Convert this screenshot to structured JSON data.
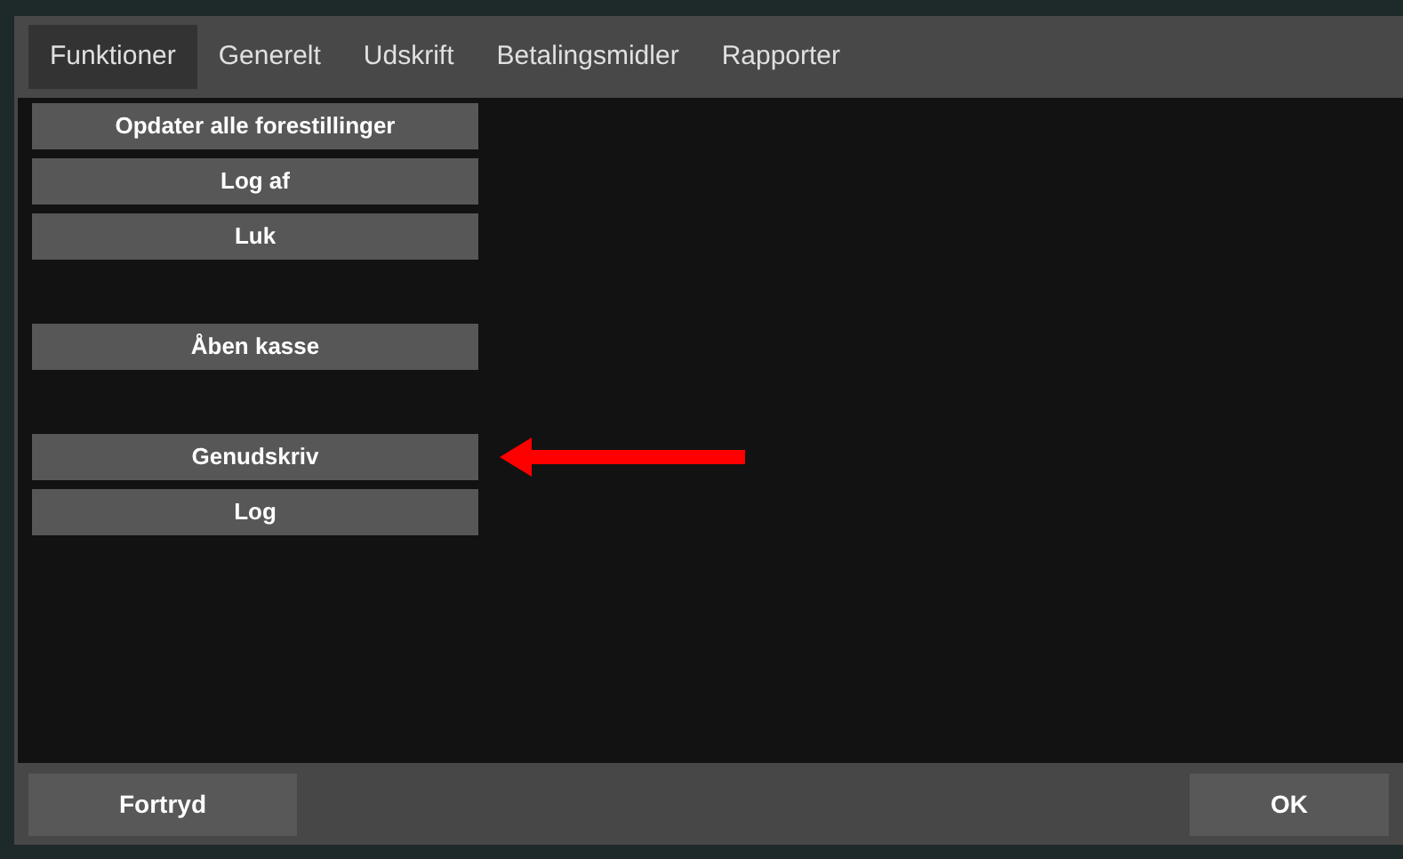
{
  "tabs": [
    {
      "label": "Funktioner",
      "selected": true
    },
    {
      "label": "Generelt",
      "selected": false
    },
    {
      "label": "Udskrift",
      "selected": false
    },
    {
      "label": "Betalingsmidler",
      "selected": false
    },
    {
      "label": "Rapporter",
      "selected": false
    }
  ],
  "button_groups": [
    [
      {
        "label": "Opdater alle forestillinger",
        "highlighted": false
      },
      {
        "label": "Log af",
        "highlighted": false
      },
      {
        "label": "Luk",
        "highlighted": false
      }
    ],
    [
      {
        "label": "Åben kasse",
        "highlighted": false
      }
    ],
    [
      {
        "label": "Genudskriv",
        "highlighted": true
      },
      {
        "label": "Log",
        "highlighted": false
      }
    ]
  ],
  "footer": {
    "cancel": "Fortryd",
    "ok": "OK"
  }
}
